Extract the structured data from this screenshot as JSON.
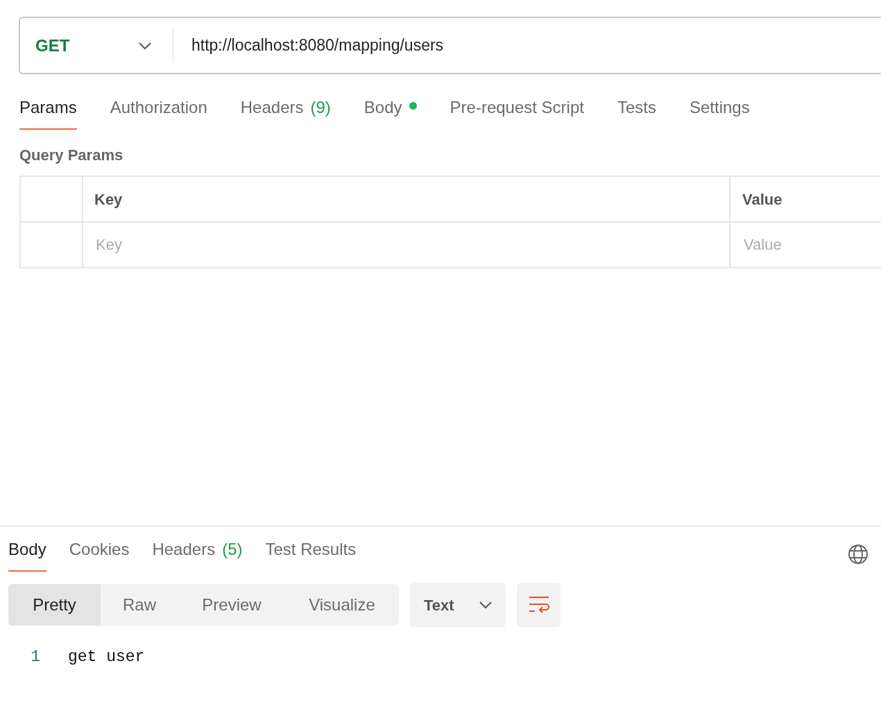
{
  "request": {
    "method": "GET",
    "url": "http://localhost:8080/mapping/users"
  },
  "request_tabs": [
    {
      "label": "Params",
      "selected": true,
      "modified": false
    },
    {
      "label": "Authorization",
      "selected": false,
      "modified": false
    },
    {
      "label": "Headers",
      "count": "(9)",
      "selected": false,
      "modified": false
    },
    {
      "label": "Body",
      "selected": false,
      "modified": true
    },
    {
      "label": "Pre-request Script",
      "selected": false,
      "modified": false
    },
    {
      "label": "Tests",
      "selected": false,
      "modified": false
    },
    {
      "label": "Settings",
      "selected": false,
      "modified": false
    }
  ],
  "query_params": {
    "title": "Query Params",
    "columns": [
      "Key",
      "Value"
    ],
    "new_row": {
      "key_placeholder": "Key",
      "value_placeholder": "Value"
    }
  },
  "response_tabs": [
    {
      "label": "Body",
      "selected": true
    },
    {
      "label": "Cookies",
      "selected": false
    },
    {
      "label": "Headers",
      "count": "(5)",
      "selected": false
    },
    {
      "label": "Test Results",
      "selected": false
    }
  ],
  "view_modes": [
    {
      "label": "Pretty",
      "selected": true
    },
    {
      "label": "Raw",
      "selected": false
    },
    {
      "label": "Preview",
      "selected": false
    },
    {
      "label": "Visualize",
      "selected": false
    }
  ],
  "format": "Text",
  "wrap_lines": true,
  "code_lines": [
    {
      "number": "1",
      "text": "get user"
    }
  ]
}
